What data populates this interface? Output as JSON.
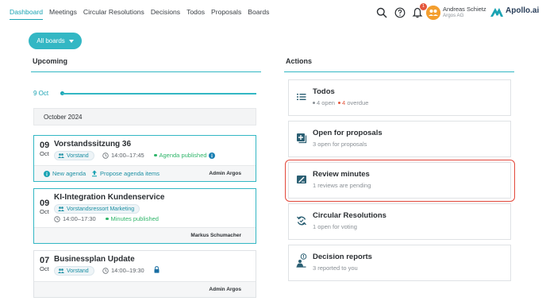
{
  "nav": {
    "items": [
      {
        "label": "Dashboard",
        "active": true
      },
      {
        "label": "Meetings",
        "active": false
      },
      {
        "label": "Circular Resolutions",
        "active": false
      },
      {
        "label": "Decisions",
        "active": false
      },
      {
        "label": "Todos",
        "active": false
      },
      {
        "label": "Proposals",
        "active": false
      },
      {
        "label": "Boards",
        "active": false
      }
    ]
  },
  "header": {
    "notification_count": "1",
    "user_name": "Andreas Schietz",
    "user_org": "Argos AG",
    "brand": "Apollo.ai",
    "icons": [
      "search-icon",
      "help-icon",
      "bell-icon",
      "avatar",
      "apollo-logo"
    ]
  },
  "boards_button": {
    "label": "All boards"
  },
  "upcoming": {
    "title": "Upcoming",
    "timeline_label": "9 Oct",
    "month_label": "October 2024",
    "meetings": [
      {
        "day": "09",
        "month": "Oct",
        "title": "Vorstandssitzung 36",
        "board": "Vorstand",
        "time": "14:00–17:45",
        "status": "Agenda published",
        "links": [
          "New agenda",
          "Propose agenda items"
        ],
        "author": "Admin Argos"
      },
      {
        "day": "09",
        "month": "Oct",
        "title": "KI-Integration Kundenservice",
        "board": "Vorstandsressort Marketing",
        "time": "14:00–17:30",
        "status": "Minutes published",
        "author": "Markus Schumacher"
      },
      {
        "day": "07",
        "month": "Oct",
        "title": "Businessplan Update",
        "board": "Vorstand",
        "time": "14:00–19:30",
        "author": "Admin Argos"
      }
    ]
  },
  "actions": {
    "title": "Actions",
    "cards": [
      {
        "title": "Todos",
        "open_count": "4",
        "open_label": "open",
        "overdue_count": "4",
        "overdue_label": "overdue",
        "icon": "list-icon"
      },
      {
        "title": "Open for proposals",
        "subtitle": "3 open for proposals",
        "icon": "add-box-icon"
      },
      {
        "title": "Review minutes",
        "subtitle": "1 reviews are pending",
        "icon": "edit-minutes-icon"
      },
      {
        "title": "Circular Resolutions",
        "subtitle": "1 open for voting",
        "icon": "cycle-icon"
      },
      {
        "title": "Decision reports",
        "subtitle": "3 reported to you",
        "icon": "report-icon"
      }
    ]
  },
  "colors": {
    "accent": "#33b7c4",
    "highlight": "#e2473a",
    "success": "#2fb56a",
    "overdue": "#e4573d"
  }
}
